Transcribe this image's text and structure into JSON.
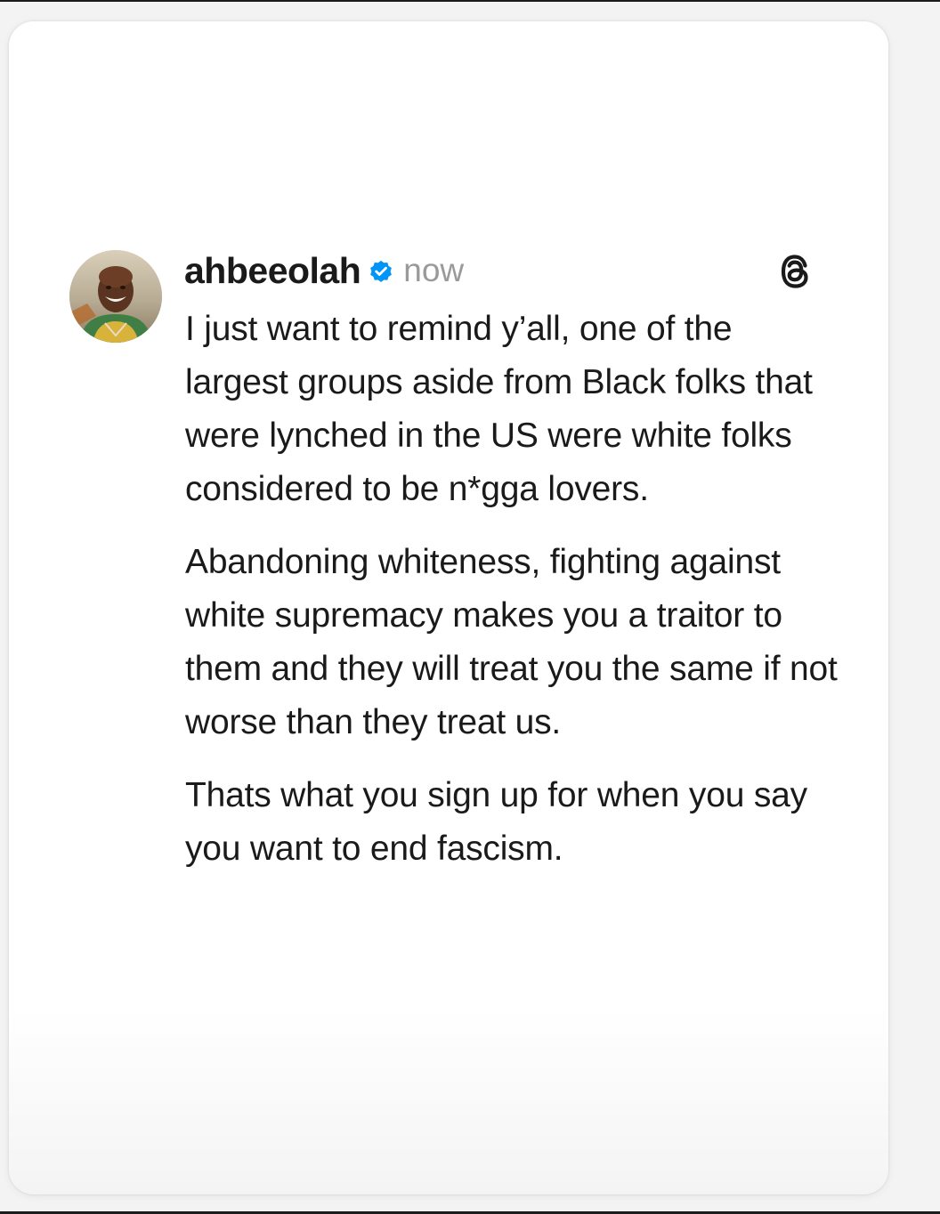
{
  "post": {
    "author": {
      "username": "ahbeeolah",
      "verified": true
    },
    "timestamp": "now",
    "paragraphs": [
      "I just want to remind y’all, one of the largest groups aside from Black folks that were lynched in the US were white folks considered to be n*gga lovers.",
      "Abandoning whiteness, fighting against white supremacy makes you a traitor to them and they will treat you the same if not worse than they treat us.",
      "Thats what you sign up for when you say you want to end fascism."
    ]
  },
  "icons": {
    "verified": "verified-badge-icon",
    "app_logo": "threads-logo-icon"
  },
  "colors": {
    "verified_badge": "#0095f6",
    "text_primary": "#1a1a1a",
    "text_secondary": "#9a9a9a"
  }
}
